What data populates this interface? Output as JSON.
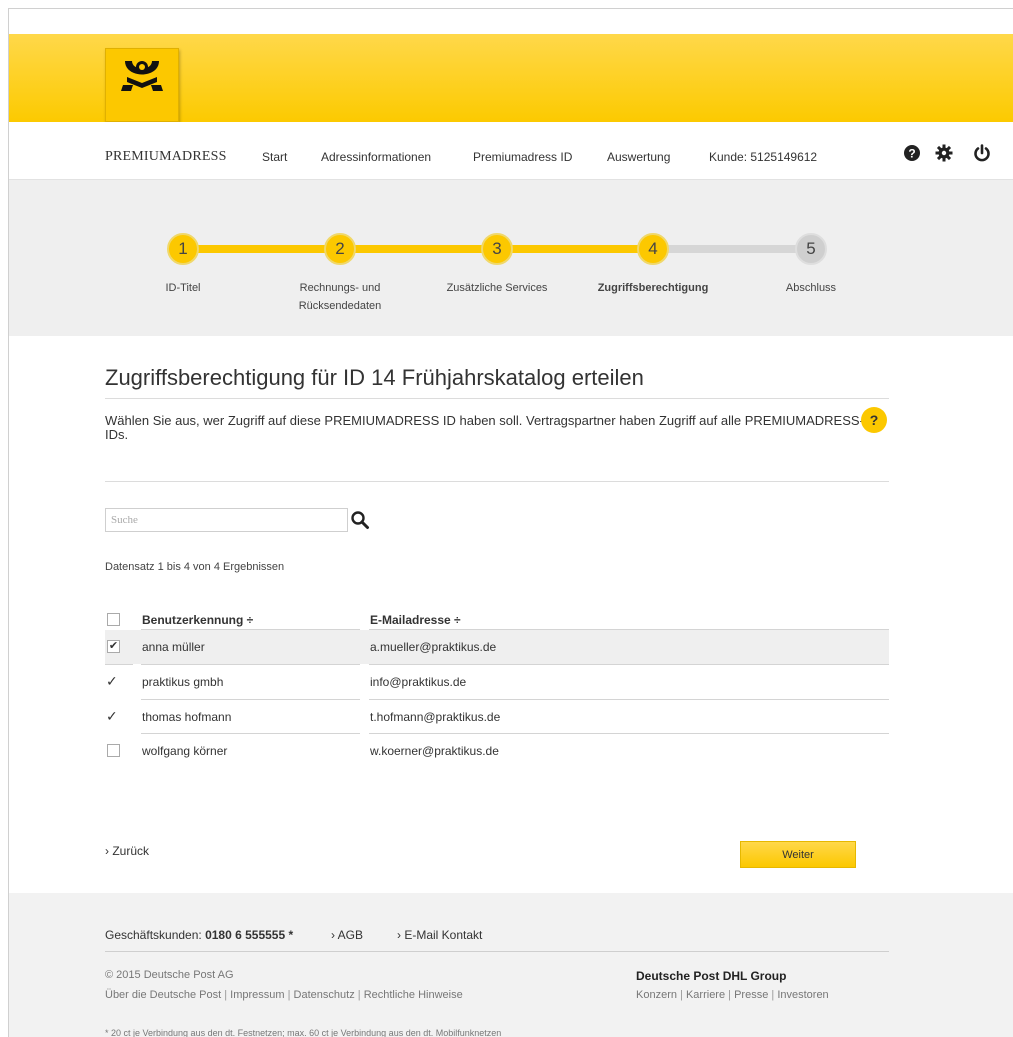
{
  "header": {
    "logo_icon": "posthorn-icon"
  },
  "nav": {
    "brand": "PREMIUMADRESS",
    "items": [
      "Start",
      "Adressinformationen",
      "Premiumadress ID",
      "Auswertung"
    ],
    "customer": "Kunde: 5125149612",
    "icons": [
      "help-icon",
      "gear-icon",
      "power-icon"
    ]
  },
  "stepper": {
    "steps": [
      {
        "num": "1",
        "label": "ID-Titel",
        "label2": "",
        "state": "done"
      },
      {
        "num": "2",
        "label": "Rechnungs- und",
        "label2": "Rücksendedaten",
        "state": "done"
      },
      {
        "num": "3",
        "label": "Zusätzliche Services",
        "label2": "",
        "state": "done"
      },
      {
        "num": "4",
        "label": "Zugriffsberechtigung",
        "label2": "",
        "state": "active"
      },
      {
        "num": "5",
        "label": "Abschluss",
        "label2": "",
        "state": "todo"
      }
    ],
    "accent": "#fcc800",
    "inactive": "#cfcfcf"
  },
  "main": {
    "title": "Zugriffsberechtigung für ID 14 Frühjahrskatalog erteilen",
    "intro": "Wählen Sie aus, wer Zugriff auf diese PREMIUMADRESS ID haben soll. Vertragspartner haben Zugriff auf alle PREMIUMADRESS-IDs.",
    "help": "?",
    "search_placeholder": "Suche",
    "count_text": "Datensatz 1 bis 4 von 4 Ergebnissen"
  },
  "table": {
    "headers": [
      "Benutzerkennung ÷",
      "E-Mailadresse ÷"
    ],
    "rows": [
      {
        "user": "anna müller",
        "email": "a.mueller@praktikus.de",
        "mark": "checkbox-checked"
      },
      {
        "user": "praktikus gmbh",
        "email": "info@praktikus.de",
        "mark": "check"
      },
      {
        "user": "thomas hofmann",
        "email": "t.hofmann@praktikus.de",
        "mark": "check"
      },
      {
        "user": "wolfgang körner",
        "email": "w.koerner@praktikus.de",
        "mark": "checkbox"
      }
    ]
  },
  "actions": {
    "back": "Zurück",
    "next": "Weiter"
  },
  "footer": {
    "phone_label": "Geschäftskunden: ",
    "phone": "0180 6 555555 *",
    "agb": "AGB",
    "contact": "E-Mail Kontakt",
    "copyright": "© 2015 Deutsche Post AG",
    "links_left": [
      "Über die Deutsche Post",
      "Impressum",
      "Datenschutz",
      "Rechtliche Hinweise"
    ],
    "group": "Deutsche Post DHL Group",
    "links_right": [
      "Konzern",
      "Karriere",
      "Presse",
      "Investoren"
    ],
    "note": "* 20 ct je Verbindung aus den dt. Festnetzen; max. 60 ct je Verbindung aus den dt. Mobilfunknetzen"
  }
}
